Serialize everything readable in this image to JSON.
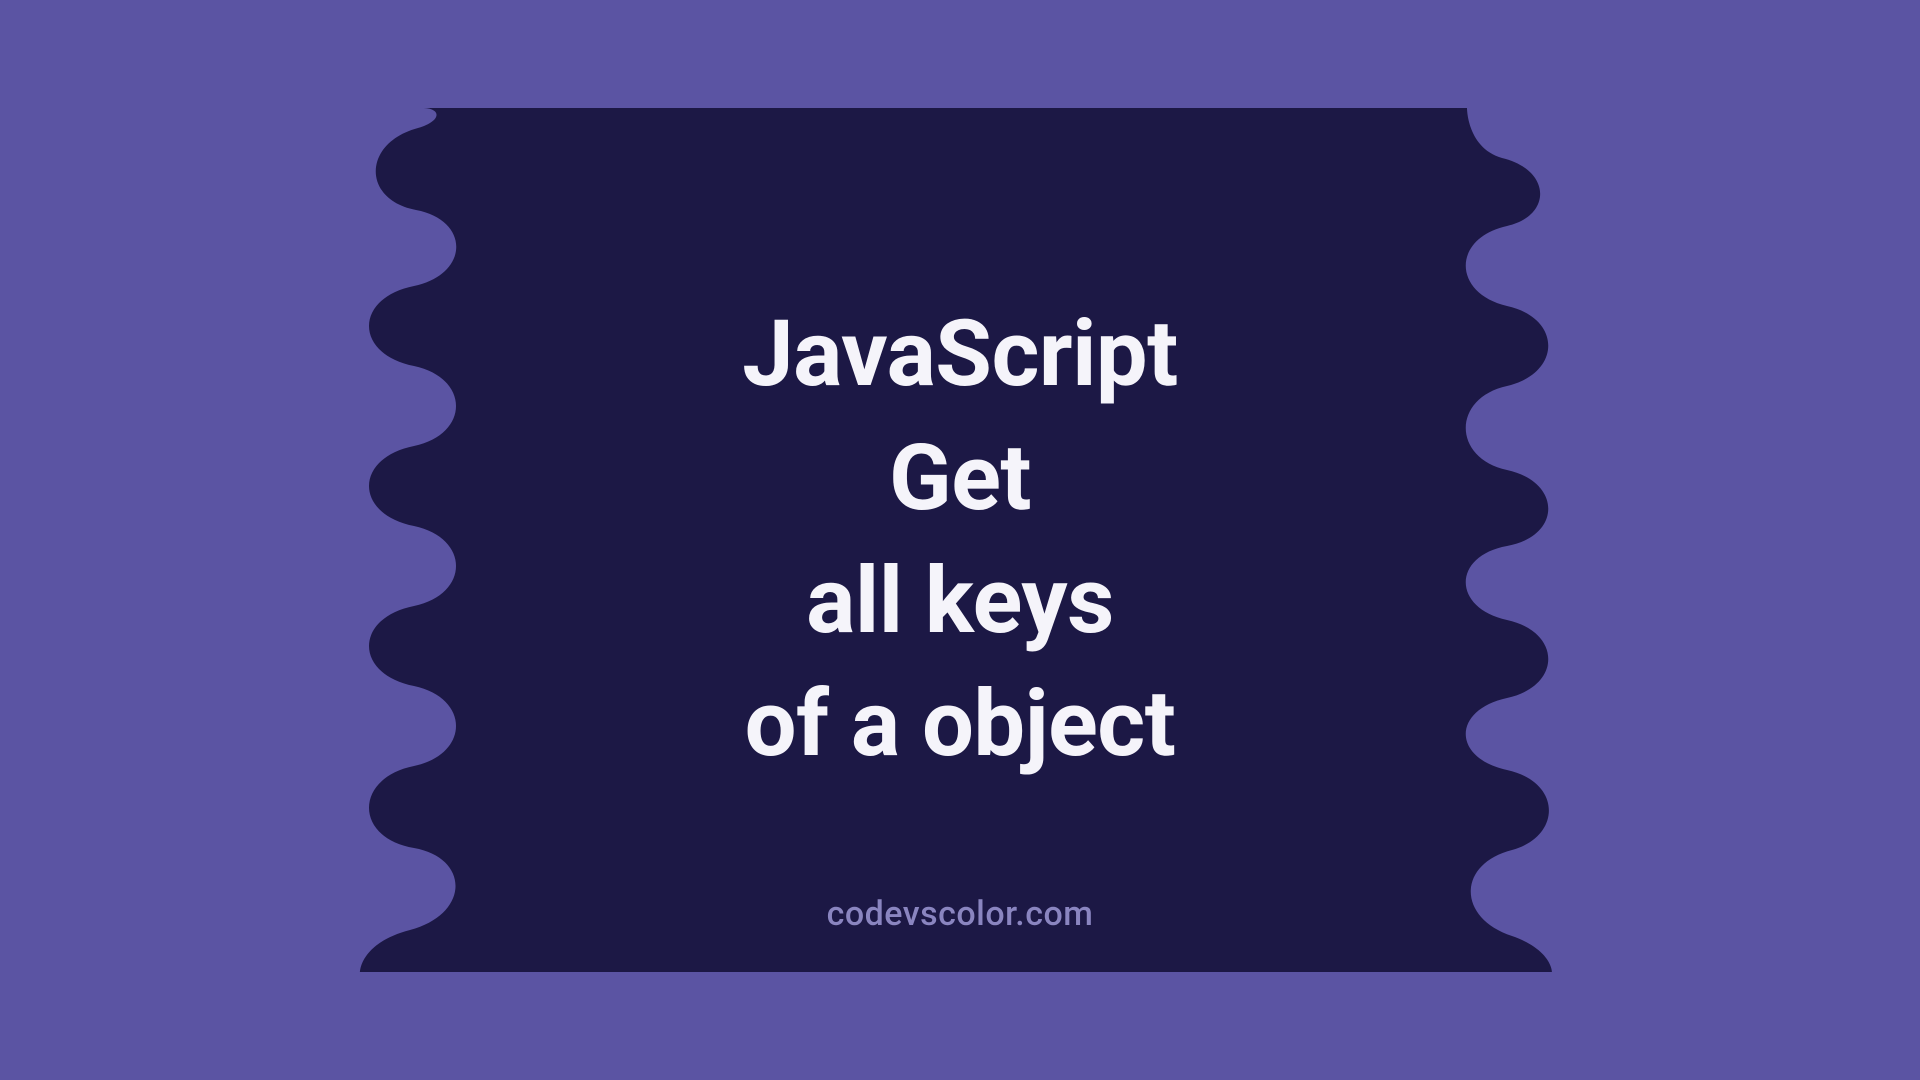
{
  "title": {
    "line1": "JavaScript",
    "line2": "Get",
    "line3": "all keys",
    "line4": "of a object"
  },
  "credit": "codevscolor.com",
  "colors": {
    "outer": "#5b54a3",
    "blob": "#1c1845",
    "text": "#f5f4fa",
    "credit": "#8a85c0"
  }
}
